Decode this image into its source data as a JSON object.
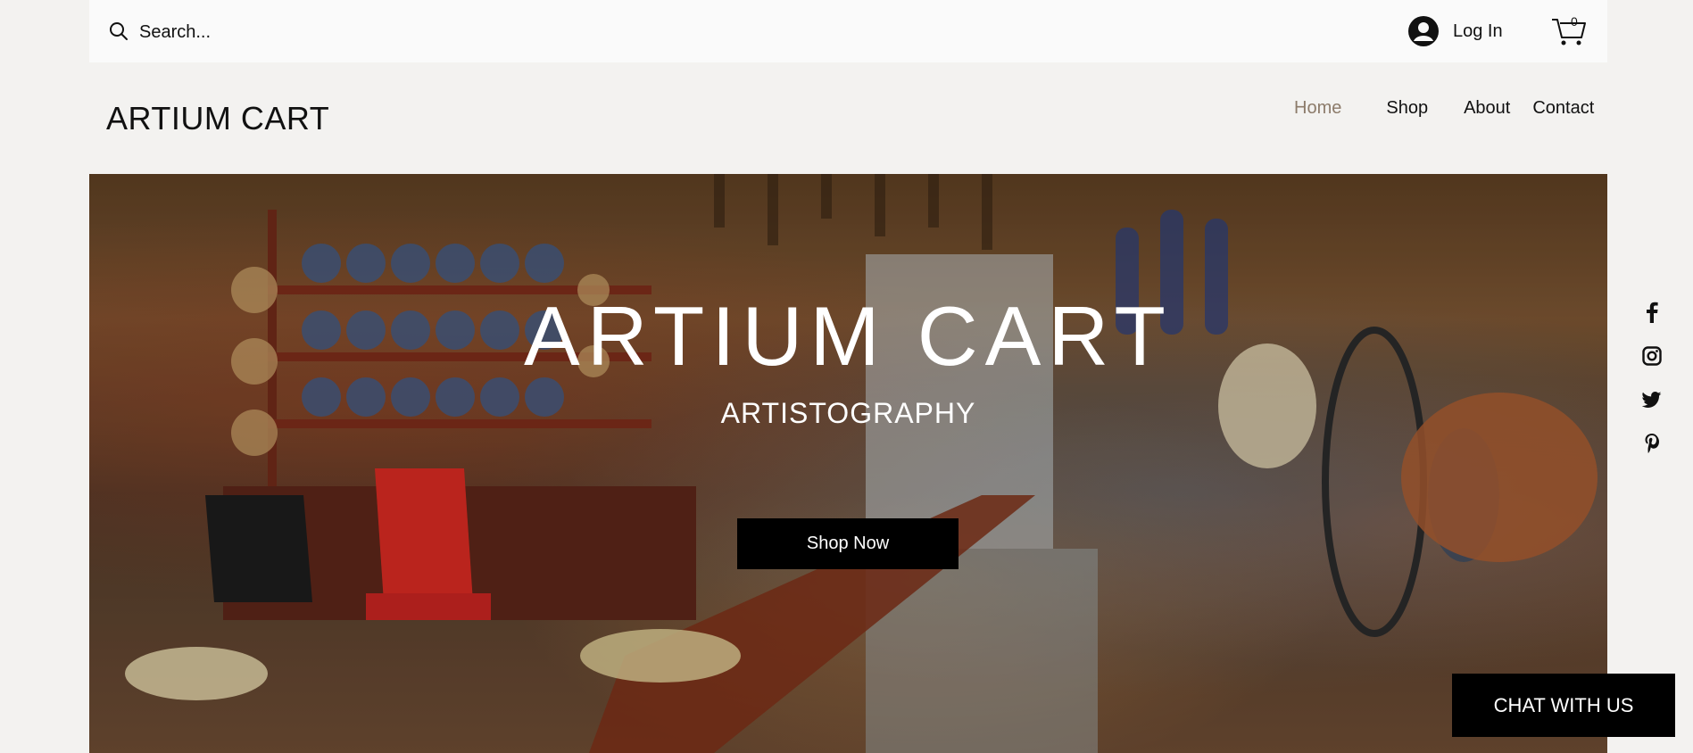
{
  "topbar": {
    "search_placeholder": "Search...",
    "login_label": "Log In",
    "cart_count": "0"
  },
  "header": {
    "brand": "ARTIUM CART",
    "nav": [
      {
        "label": "Home",
        "active": true
      },
      {
        "label": "Shop",
        "active": false
      },
      {
        "label": "About",
        "active": false
      },
      {
        "label": "Contact",
        "active": false
      }
    ]
  },
  "hero": {
    "title": "ARTIUM CART",
    "subtitle": "ARTISTOGRAPHY",
    "cta_label": "Shop Now"
  },
  "social": [
    "facebook-icon",
    "instagram-icon",
    "twitter-icon",
    "pinterest-icon"
  ],
  "chat": {
    "label": "CHAT WITH US"
  },
  "colors": {
    "nav_active": "#8c7b6a",
    "background": "#f3f2f0",
    "topbar": "#fafafa"
  }
}
